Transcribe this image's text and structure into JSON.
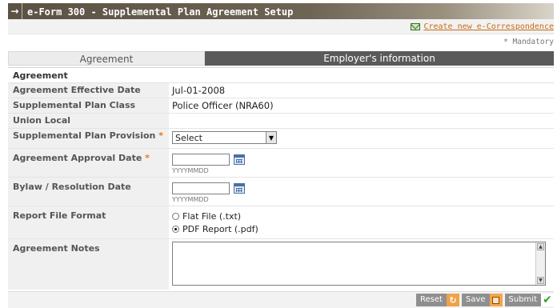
{
  "header": {
    "arrow": "→",
    "title": "e-Form 300 - Supplemental Plan Agreement Setup"
  },
  "link_bar": {
    "create_correspondence": "Create new e-Correspondence"
  },
  "mandatory_note": "* Mandatory",
  "tabs": [
    {
      "label": "Agreement",
      "active": true
    },
    {
      "label": "Employer's information",
      "active": false
    }
  ],
  "form": {
    "section_title": "Agreement",
    "effective_date": {
      "label": "Agreement Effective Date",
      "value": "Jul-01-2008"
    },
    "plan_class": {
      "label": "Supplemental Plan Class",
      "value": "Police Officer (NRA60)"
    },
    "union_local": {
      "label": "Union Local",
      "value": ""
    },
    "plan_provision": {
      "label": "Supplemental Plan Provision",
      "required": "*",
      "selected": "Select"
    },
    "approval_date": {
      "label": "Agreement Approval Date",
      "required": "*",
      "value": "",
      "hint": "YYYYMMDD"
    },
    "bylaw_date": {
      "label": "Bylaw / Resolution Date",
      "value": "",
      "hint": "YYYYMMDD"
    },
    "report_format": {
      "label": "Report File Format",
      "options": [
        {
          "label": "Flat File (.txt)",
          "checked": false
        },
        {
          "label": "PDF Report (.pdf)",
          "checked": true
        }
      ]
    },
    "notes": {
      "label": "Agreement Notes",
      "value": ""
    }
  },
  "actions": {
    "reset": "Reset",
    "save": "Save",
    "submit": "Submit"
  },
  "colors": {
    "title_bar": "#5b5244",
    "active_tab": "#ececec",
    "inactive_tab": "#5a5a5a",
    "link": "#c86b12",
    "required_star": "#e07b1e",
    "submit_check": "#31a62b"
  },
  "icons": {
    "header": "arrow-right-icon",
    "correspondence": "envelope-icon",
    "calendar": "calendar-icon",
    "reset": "refresh-icon",
    "save": "save-icon",
    "submit": "checkmark-icon"
  }
}
